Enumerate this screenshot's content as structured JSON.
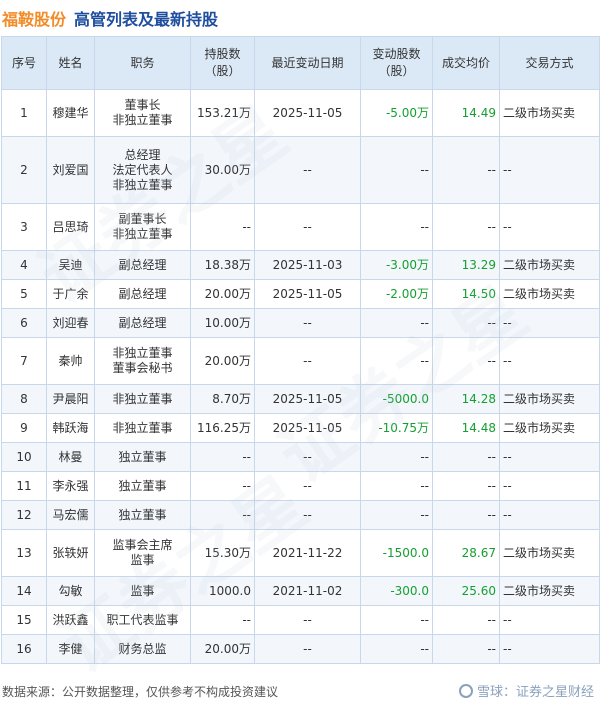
{
  "header": {
    "stock_name": "福鞍股份",
    "table_title": "高管列表及最新持股"
  },
  "columns": [
    "序号",
    "姓名",
    "职务",
    "持股数\n（股）",
    "最近变动日期",
    "变动股数\n（股）",
    "成交均价",
    "交易方式"
  ],
  "rows": [
    [
      "1",
      "穆建华",
      "董事长\n非独立董事",
      "153.21万",
      "2025-11-05",
      "-5.00万",
      "14.49",
      "二级市场买卖"
    ],
    [
      "2",
      "刘爱国",
      "总经理\n法定代表人\n非独立董事",
      "30.00万",
      "--",
      "--",
      "--",
      "--"
    ],
    [
      "3",
      "吕思琦",
      "副董事长\n非独立董事",
      "--",
      "--",
      "--",
      "--",
      "--"
    ],
    [
      "4",
      "吴迪",
      "副总经理",
      "18.38万",
      "2025-11-03",
      "-3.00万",
      "13.29",
      "二级市场买卖"
    ],
    [
      "5",
      "于广余",
      "副总经理",
      "20.00万",
      "2025-11-05",
      "-2.00万",
      "14.50",
      "二级市场买卖"
    ],
    [
      "6",
      "刘迎春",
      "副总经理",
      "10.00万",
      "--",
      "--",
      "--",
      "--"
    ],
    [
      "7",
      "秦帅",
      "非独立董事\n董事会秘书",
      "20.00万",
      "--",
      "--",
      "--",
      "--"
    ],
    [
      "8",
      "尹晨阳",
      "非独立董事",
      "8.70万",
      "2025-11-05",
      "-5000.0",
      "14.28",
      "二级市场买卖"
    ],
    [
      "9",
      "韩跃海",
      "非独立董事",
      "116.25万",
      "2025-11-05",
      "-10.75万",
      "14.48",
      "二级市场买卖"
    ],
    [
      "10",
      "林曼",
      "独立董事",
      "--",
      "--",
      "--",
      "--",
      "--"
    ],
    [
      "11",
      "李永强",
      "独立董事",
      "--",
      "--",
      "--",
      "--",
      "--"
    ],
    [
      "12",
      "马宏儒",
      "独立董事",
      "--",
      "--",
      "--",
      "--",
      "--"
    ],
    [
      "13",
      "张轶妍",
      "监事会主席\n监事",
      "15.30万",
      "2021-11-22",
      "-1500.0",
      "28.67",
      "二级市场买卖"
    ],
    [
      "14",
      "勾敏",
      "监事",
      "1000.0",
      "2021-11-02",
      "-300.0",
      "25.60",
      "二级市场买卖"
    ],
    [
      "15",
      "洪跃鑫",
      "职工代表监事",
      "--",
      "--",
      "--",
      "--",
      "--"
    ],
    [
      "16",
      "李健",
      "财务总监",
      "20.00万",
      "--",
      "--",
      "--",
      "--"
    ]
  ],
  "footer": {
    "source": "数据来源：公开数据整理，仅供参考不构成投资建议",
    "brand": "雪球：证券之星财经"
  },
  "colors": {
    "accent_orange": "#f28c28",
    "title_blue": "#1f4e9e",
    "change_green": "#14a030",
    "header_bg": "#dbe8f6"
  }
}
